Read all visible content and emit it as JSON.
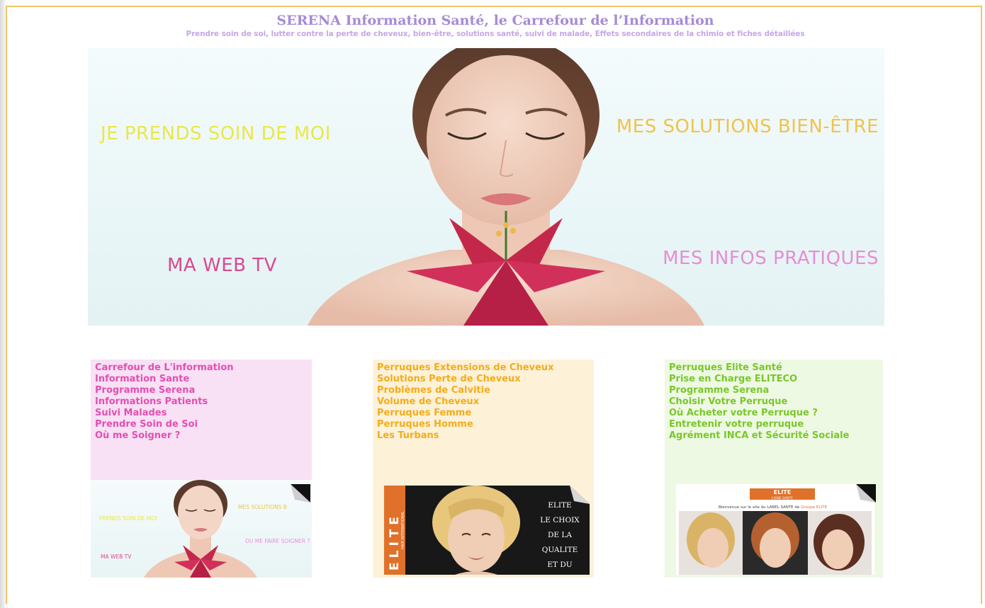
{
  "header": {
    "title": "SERENA Information Santé, le Carrefour de l’Information",
    "subtitle": "Prendre soin de soi, lutter contre la perte de cheveux, bien-être, solutions santé, suivi de malade, Effets secondaires de la chimio et fiches détaillées"
  },
  "hero": {
    "links": {
      "soin": "JE PRENDS SOIN DE MOI",
      "solutions": "MES SOLUTIONS BIEN-ÊTRE",
      "webtv": "MA WEB TV",
      "infos": "MES INFOS PRATIQUES"
    }
  },
  "columns": {
    "pink": {
      "items": [
        "Carrefour de L'information",
        "Information Sante",
        "Programme Serena",
        "Informations Patients",
        "Suivi Malades",
        "Prendre Soin de Soi",
        "Où me Soigner ?"
      ]
    },
    "peach": {
      "items": [
        "Perruques Extensions de Cheveux",
        "Solutions Perte de Cheveux",
        "Problèmes de Calvitie",
        "Volume de Cheveux",
        "Perruques Femme",
        "Perruques Homme",
        "Les Turbans"
      ]
    },
    "green": {
      "items": [
        "Perruques Elite Santé",
        "Prise en Charge ELITECO",
        "Programme Serena",
        "Choisir Votre Perruque",
        "Où Acheter votre Perruque ?",
        "Entretenir votre perruque",
        "Agrément INCA et Sécurité Sociale"
      ]
    }
  },
  "thumbs": {
    "one": {
      "soin": "PRENDS SOIN DE MOI",
      "solutions": "MES SOLUTIONS B",
      "soigner": "OU ME FAIRE SOIGNER ?",
      "webtv": "MA WEB TV"
    },
    "two": {
      "brand": "ELITE",
      "brand_sub": "HAIR INTERNATIONAL",
      "tagline": [
        "ELITE",
        "LE CHOIX",
        "DE LA QUALITE",
        "ET DU NATUREL"
      ]
    },
    "three": {
      "brand": "ELITE",
      "brand_sub": "LIGNE SANTE",
      "welcome_pre": "Bienvenue sur le site du LABEL SANTE de",
      "welcome_group": "Groupe ELITE"
    }
  },
  "colors": {
    "title": "#a58bd6",
    "pink_links": "#e34fb1",
    "peach_links": "#f2ad1c",
    "green_links": "#79c72a",
    "accent_orange": "#e0712a"
  }
}
